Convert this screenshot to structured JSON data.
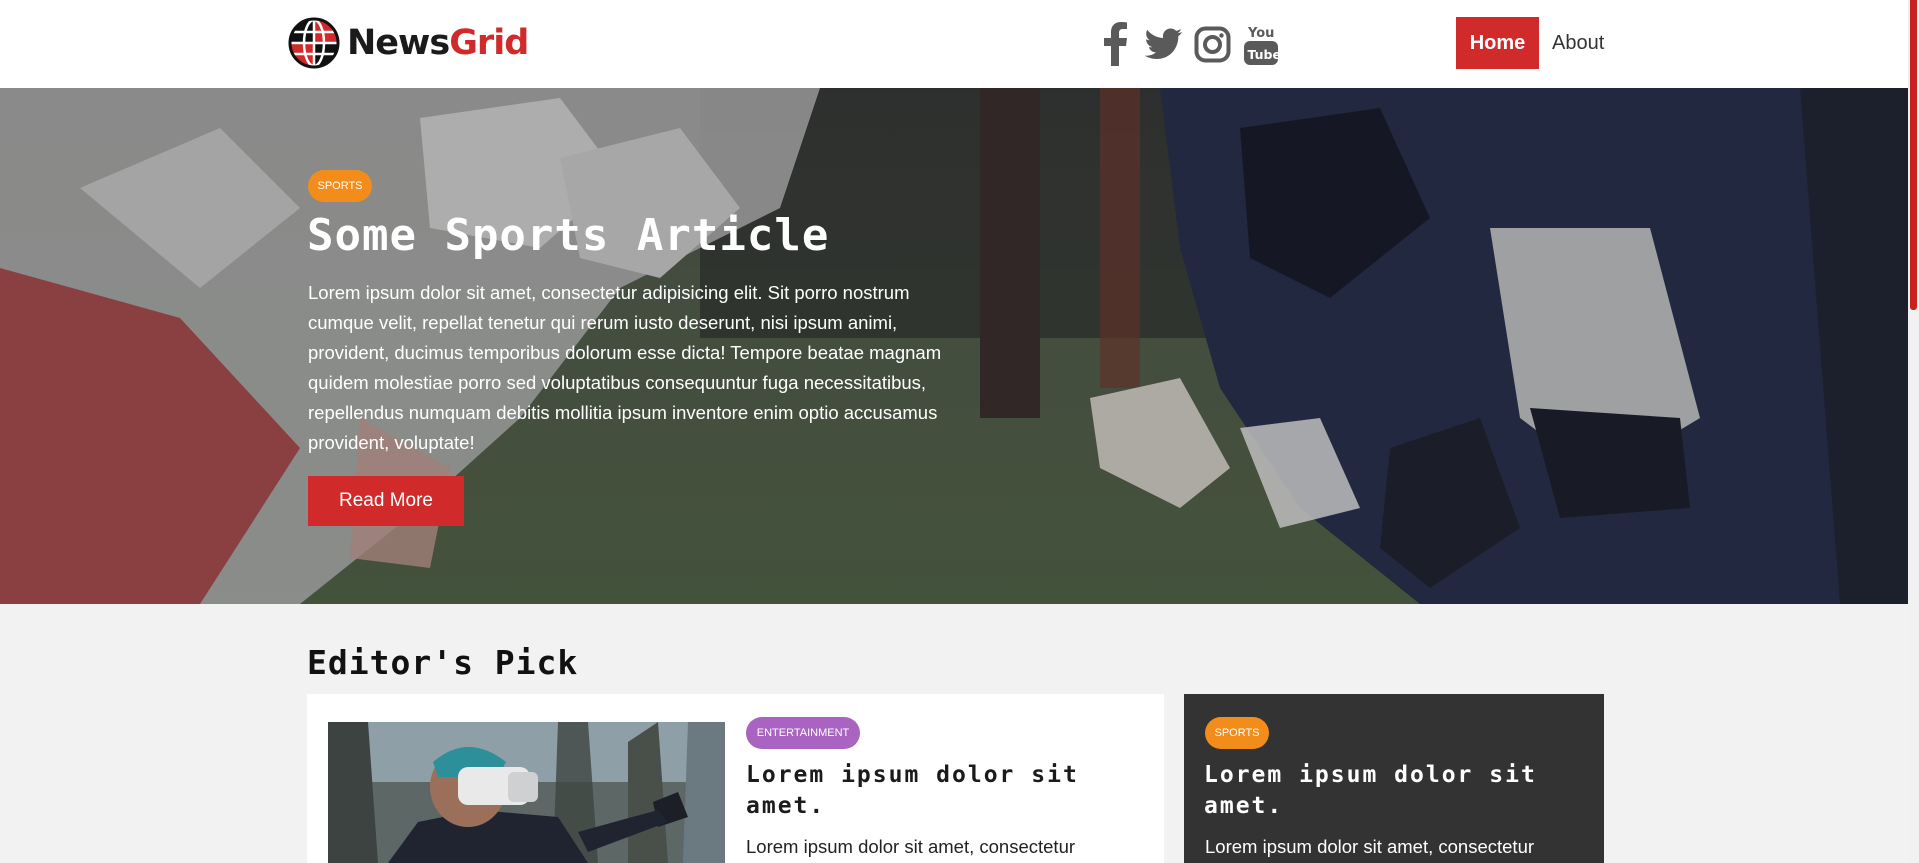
{
  "header": {
    "logo_part1": "News",
    "logo_part2": "Grid",
    "social_icons": [
      "facebook-icon",
      "twitter-icon",
      "instagram-icon",
      "youtube-icon"
    ],
    "nav": {
      "home": "Home",
      "about": "About"
    }
  },
  "hero": {
    "category": "SPORTS",
    "title": "Some Sports Article",
    "text": "Lorem ipsum dolor sit amet, consectetur adipisicing elit. Sit porro nostrum cumque velit, repellat tenetur qui rerum iusto deserunt, nisi ipsum animi, provident, ducimus temporibus dolorum esse dicta! Tempore beatae magnam quidem molestiae porro sed voluptatibus consequuntur fuga necessitatibus, repellendus numquam debitis mollitia ipsum inventore enim optio accusamus provident, voluptate!",
    "button": "Read More"
  },
  "editors_pick": {
    "heading": "Editor's Pick",
    "main_card": {
      "category": "ENTERTAINMENT",
      "title": "Lorem ipsum dolor sit amet.",
      "text": "Lorem ipsum dolor sit amet, consectetur"
    },
    "side_card": {
      "category": "SPORTS",
      "title": "Lorem ipsum dolor sit amet.",
      "text": "Lorem ipsum dolor sit amet, consectetur"
    }
  },
  "colors": {
    "brand_red": "#d12a2a",
    "sports_badge": "#f28c1a",
    "entertainment_badge": "#a864c0",
    "dark_card": "#333333"
  }
}
